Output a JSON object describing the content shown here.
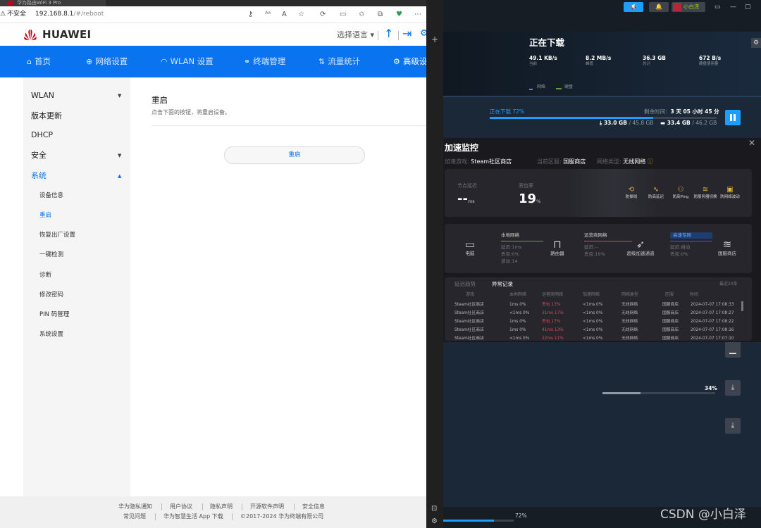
{
  "browser": {
    "tab_title": "华为路由WiFi 3 Pro",
    "security_warning_icon": "warning-icon",
    "security_label": "不安全",
    "url_host": "192.168.8.1",
    "url_path": "/#/reboot"
  },
  "router": {
    "brand": "HUAWEI",
    "language_label": "选择语言 ▾",
    "nav": [
      {
        "icon": "⌂",
        "label": "首页"
      },
      {
        "icon": "⊕",
        "label": "网络设置"
      },
      {
        "icon": "◠",
        "label": "WLAN 设置"
      },
      {
        "icon": "⚭",
        "label": "终端管理"
      },
      {
        "icon": "⇅",
        "label": "流量统计"
      },
      {
        "icon": "⚙",
        "label": "高级设置"
      }
    ],
    "sidebar": {
      "wlan": "WLAN",
      "update": "版本更新",
      "dhcp": "DHCP",
      "security": "安全",
      "system": "系统",
      "sub": [
        "设备信息",
        "重启",
        "恢复出厂设置",
        "一键检测",
        "诊断",
        "修改密码",
        "PIN 码管理",
        "系统设置"
      ]
    },
    "page": {
      "title": "重启",
      "description": "点击下面的按钮，将重启设备。",
      "reboot_button": "重启"
    },
    "footer": {
      "links": [
        "华为隐私通知",
        "用户协议",
        "隐私声明",
        "开源软件声明",
        "安全信息"
      ],
      "faq": "常见问题",
      "app": "华为智慧生活 App 下载",
      "copyright": "©2017-2024 华为终端有限公司"
    }
  },
  "steam": {
    "username": "小白泽",
    "downloads": {
      "title": "正在下载",
      "stats": [
        {
          "value": "49.1 KB/s",
          "label": "当前"
        },
        {
          "value": "8.2 MB/s",
          "label": "峰值"
        },
        {
          "value": "36.3 GB",
          "label": "总计"
        },
        {
          "value": "672 B/s",
          "label": "硬盘使用量"
        }
      ],
      "legend_network": "网络",
      "legend_disk": "硬盘",
      "status": "正在下载 72%",
      "progress": 0.72,
      "remaining_label": "剩余时间：",
      "remaining_value": "3 天 05 小时 45 分",
      "downloaded": "33.0 GB",
      "download_total": "/ 45.8 GB",
      "disk": "33.4 GB",
      "disk_total": "/ 46.2 GB"
    },
    "accel": {
      "title": "加速监控",
      "game_label": "加速游戏:",
      "game_value": "Steam社区商店",
      "region_label": "当前区服:",
      "region_value": "国服商店",
      "net_label": "网络类型:",
      "net_value": "无线网络",
      "tip_icon": "ⓘ",
      "latency_label": "节点延迟",
      "latency_value": "--",
      "latency_unit": "ms",
      "loss_label": "丢包率",
      "loss_value": "19",
      "loss_unit": "%",
      "features": [
        {
          "icon": "⟲",
          "label": "防掉线"
        },
        {
          "icon": "∿",
          "label": "防高延迟"
        },
        {
          "icon": "⚇",
          "label": "防高Ping"
        },
        {
          "icon": "≋",
          "label": "防服务器切换"
        },
        {
          "icon": "▣",
          "label": "防网络波动"
        }
      ],
      "path": {
        "pc": "电脑",
        "router": "路由器",
        "accel": "超级加速通道",
        "store": "国服商店",
        "local_tag": "本地网络",
        "local_lines": [
          "延迟:1ms",
          "丢包:0%",
          "波动:14"
        ],
        "isp_tag": "运营商网络",
        "isp_lines": [
          "延迟:--",
          "丢包:19%"
        ],
        "fast_tag": "高速专网",
        "fast_lines": [
          "延迟:自动",
          "丢包:0%"
        ]
      },
      "log": {
        "tab_latency": "延迟趋势",
        "tab_anomaly": "异常记录",
        "recent": "最近20条",
        "headers": [
          "游戏",
          "本地网络",
          "运营商网络",
          "加速网络",
          "网络类型",
          "区服",
          "时间"
        ],
        "rows": [
          [
            "Steam社区商店",
            "1ms 0%",
            "丢包 13%",
            "<1ms 0%",
            "无线网络",
            "国服商店",
            "2024-07-07 17:08:33"
          ],
          [
            "Steam社区商店",
            "<1ms 0%",
            "31ms 17%",
            "<1ms 0%",
            "无线网络",
            "国服商店",
            "2024-07-07 17:08:27"
          ],
          [
            "Steam社区商店",
            "1ms 0%",
            "丢包 17%",
            "<1ms 0%",
            "无线网络",
            "国服商店",
            "2024-07-07 17:08:22"
          ],
          [
            "Steam社区商店",
            "1ms 0%",
            "41ms 13%",
            "<1ms 0%",
            "无线网络",
            "国服商店",
            "2024-07-07 17:08:16"
          ],
          [
            "Steam社区商店",
            "<1ms 0%",
            "22ms 11%",
            "<1ms 0%",
            "无线网络",
            "国服商店",
            "2024-07-07 17:07:10"
          ]
        ]
      }
    },
    "queue": {
      "percent_label": "34%",
      "percent": 0.34
    },
    "bottom": {
      "percent_label": "72%",
      "percent": 0.72
    }
  },
  "watermark": "CSDN @小白泽"
}
